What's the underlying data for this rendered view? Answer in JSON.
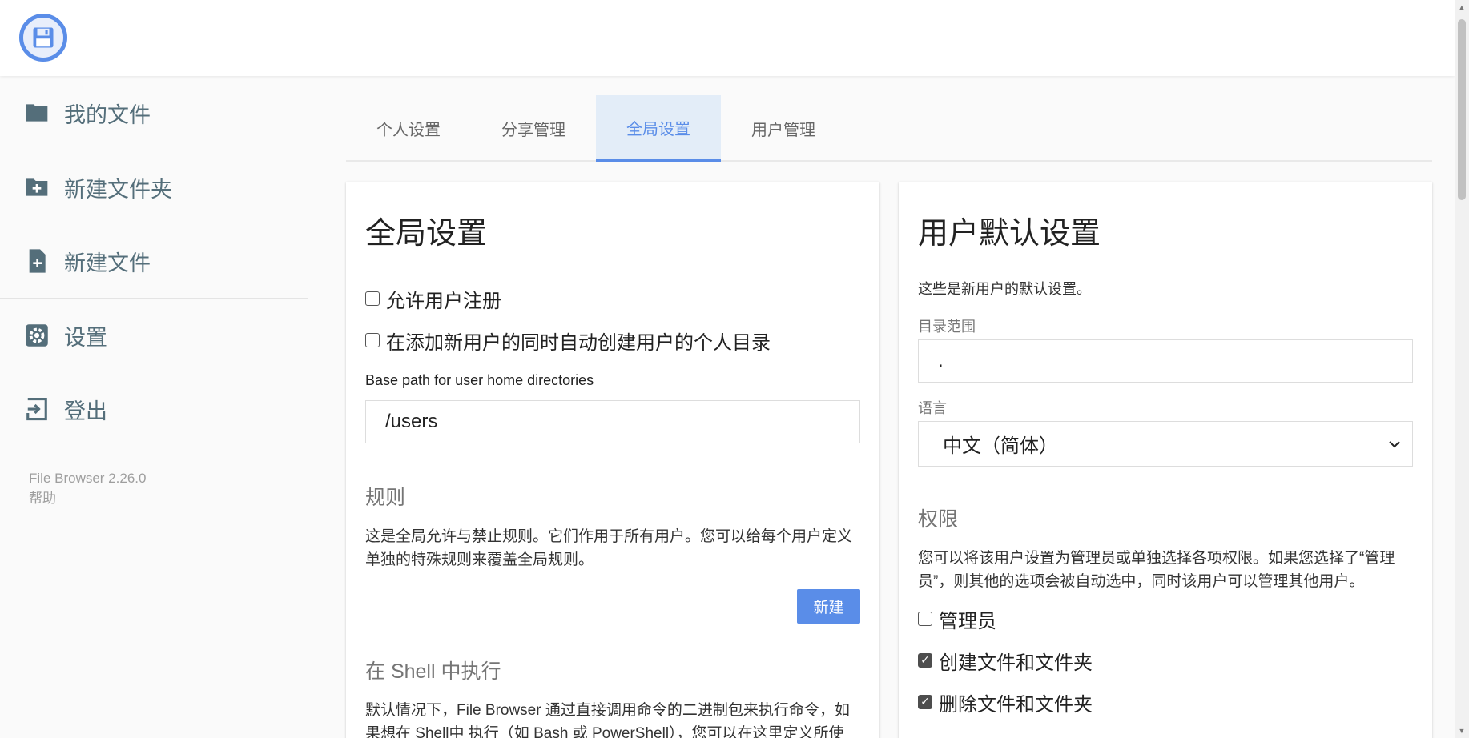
{
  "sidebar": {
    "items": [
      {
        "label": "我的文件",
        "icon": "folder-icon"
      },
      {
        "label": "新建文件夹",
        "icon": "folder-plus-icon"
      },
      {
        "label": "新建文件",
        "icon": "file-plus-icon"
      },
      {
        "label": "设置",
        "icon": "gear-icon"
      },
      {
        "label": "登出",
        "icon": "logout-icon"
      }
    ],
    "version": "File Browser 2.26.0",
    "help": "帮助"
  },
  "tabs": [
    {
      "label": "个人设置",
      "active": false
    },
    {
      "label": "分享管理",
      "active": false
    },
    {
      "label": "全局设置",
      "active": true
    },
    {
      "label": "用户管理",
      "active": false
    }
  ],
  "global": {
    "title": "全局设置",
    "allow_signup": {
      "label": "允许用户注册",
      "checked": false
    },
    "create_home": {
      "label": "在添加新用户的同时自动创建用户的个人目录",
      "checked": false
    },
    "base_path_label": "Base path for user home directories",
    "base_path_value": "/users",
    "rules_title": "规则",
    "rules_desc": "这是全局允许与禁止规则。它们作用于所有用户。您可以给每个用户定义单独的特殊规则来覆盖全局规则。",
    "new_button": "新建",
    "shell_title": "在 Shell 中执行",
    "shell_desc": "默认情况下，File Browser 通过直接调用命令的二进制包来执行命令，如果想在 Shell中 执行（如 Bash 或 PowerShell），您可以在这里定义所使"
  },
  "defaults": {
    "title": "用户默认设置",
    "desc": "这些是新用户的默认设置。",
    "scope_label": "目录范围",
    "scope_value": ".",
    "language_label": "语言",
    "language_value": "中文（简体）",
    "permissions_title": "权限",
    "permissions_desc": "您可以将该用户设置为管理员或单独选择各项权限。如果您选择了“管理员”，则其他的选项会被自动选中，同时该用户可以管理其他用户。",
    "perms": [
      {
        "label": "管理员",
        "checked": false
      },
      {
        "label": "创建文件和文件夹",
        "checked": true
      },
      {
        "label": "删除文件和文件夹",
        "checked": true
      }
    ]
  },
  "colors": {
    "accent": "#5a8de8",
    "icon": "#546e7a"
  }
}
